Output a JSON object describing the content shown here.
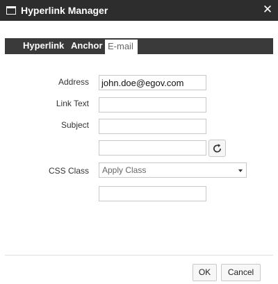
{
  "window": {
    "title": "Hyperlink Manager",
    "close_glyph": "✕",
    "icon": "window-icon"
  },
  "tabs": [
    {
      "label": "Hyperlink",
      "active": false
    },
    {
      "label": "Anchor",
      "active": false
    },
    {
      "label": "E-mail",
      "active": true
    }
  ],
  "form": {
    "address": {
      "label": "Address",
      "value": "john.doe@egov.com"
    },
    "link_text": {
      "label": "Link Text",
      "value": ""
    },
    "subject": {
      "label": "Subject",
      "value": ""
    },
    "extra_field": {
      "value": ""
    },
    "refresh_icon": "refresh-icon",
    "css_class": {
      "label": "CSS Class",
      "selected": "Apply Class"
    },
    "class_field": {
      "value": ""
    }
  },
  "buttons": {
    "ok": "OK",
    "cancel": "Cancel"
  },
  "colors": {
    "titlebar": "#2d2d2d",
    "tabstrip": "#3a3a3a"
  }
}
